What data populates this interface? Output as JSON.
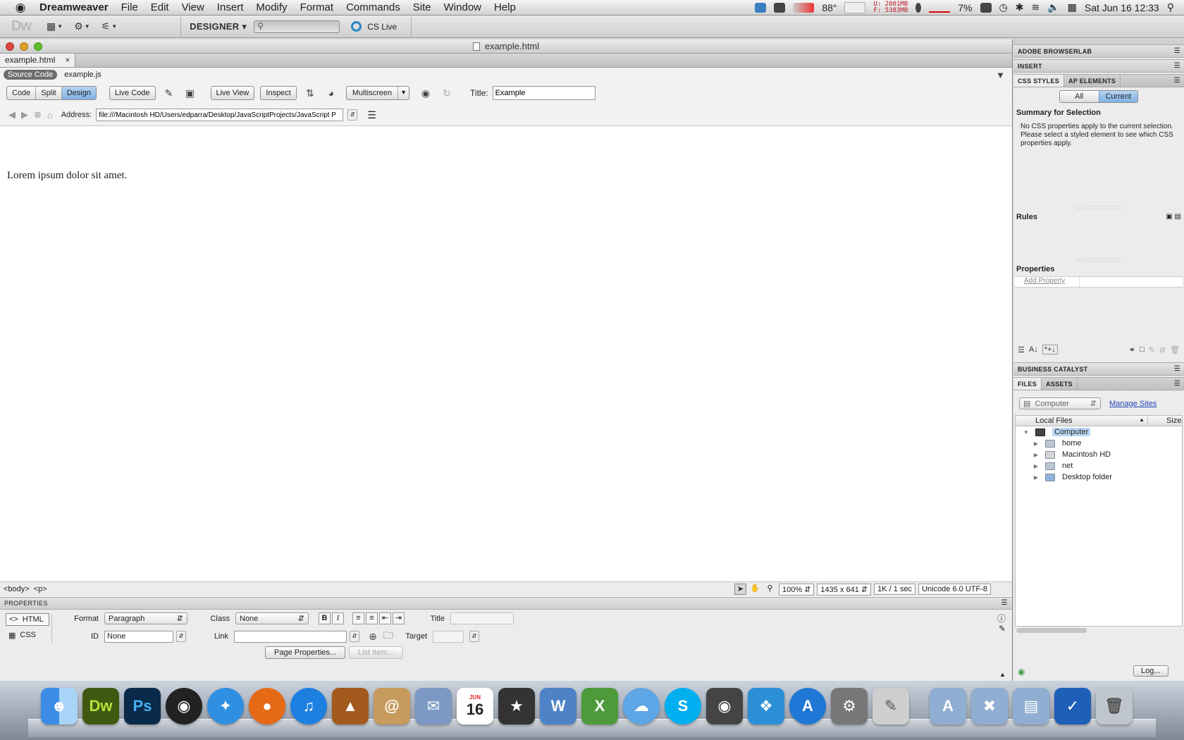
{
  "menubar": {
    "apple": "",
    "items": [
      "Dreamweaver",
      "File",
      "Edit",
      "View",
      "Insert",
      "Modify",
      "Format",
      "Commands",
      "Site",
      "Window",
      "Help"
    ],
    "temperature": "88°",
    "mem_used": "U: 2801MB",
    "mem_free": "F: 5383MB",
    "battery": "7%",
    "clock": "Sat Jun 16  12:33"
  },
  "apptoolbar": {
    "logo": "Dw",
    "workspace": "DESIGNER",
    "cs_live": "CS Live"
  },
  "window": {
    "title": "example.html"
  },
  "tabs": {
    "active": "example.html",
    "close": "×"
  },
  "related": {
    "source_code": "Source Code",
    "file": "example.js"
  },
  "doctoolbar": {
    "views": [
      "Code",
      "Split",
      "Design"
    ],
    "live_code": "Live Code",
    "live_view": "Live View",
    "inspect": "Inspect",
    "multiscreen": "Multiscreen",
    "title_label": "Title:",
    "title_value": "Example"
  },
  "address": {
    "label": "Address:",
    "value": "file:///Macintosh HD/Users/edparra/Desktop/JavaScriptProjects/JavaScript P"
  },
  "design": {
    "text": "Lorem ipsum dolor sit amet."
  },
  "statusbar": {
    "tags": [
      "<body>",
      "<p>"
    ],
    "zoom": "100%",
    "size": "1435 x 641",
    "download": "1K / 1 sec",
    "encoding": "Unicode 6.0 UTF-8"
  },
  "properties": {
    "header": "PROPERTIES",
    "html_label": "HTML",
    "css_label": "CSS",
    "format_label": "Format",
    "format_value": "Paragraph",
    "class_label": "Class",
    "class_value": "None",
    "id_label": "ID",
    "id_value": "None",
    "link_label": "Link",
    "title_label": "Title",
    "target_label": "Target",
    "page_properties": "Page Properties...",
    "list_item": "List Item..."
  },
  "right": {
    "browserlab": "ADOBE BROWSERLAB",
    "insert": "INSERT",
    "css_styles": "CSS STYLES",
    "ap_elements": "AP ELEMENTS",
    "all": "All",
    "current": "Current",
    "summary_title": "Summary for Selection",
    "summary_text": "No CSS properties apply to the current selection.  Please select a styled element to see which CSS properties apply.",
    "rules": "Rules",
    "properties": "Properties",
    "add_property": "Add Property",
    "business_catalyst": "BUSINESS CATALYST",
    "files": "FILES",
    "assets": "ASSETS",
    "site_select": "Computer",
    "manage_sites": "Manage Sites",
    "col_local": "Local Files",
    "col_size": "Size",
    "tree": [
      "Computer",
      "home",
      "Macintosh HD",
      "net",
      "Desktop folder"
    ],
    "log": "Log..."
  },
  "dock": {
    "dw": "Dw",
    "ps": "Ps",
    "calendar_month": "JUN",
    "calendar_day": "16"
  }
}
